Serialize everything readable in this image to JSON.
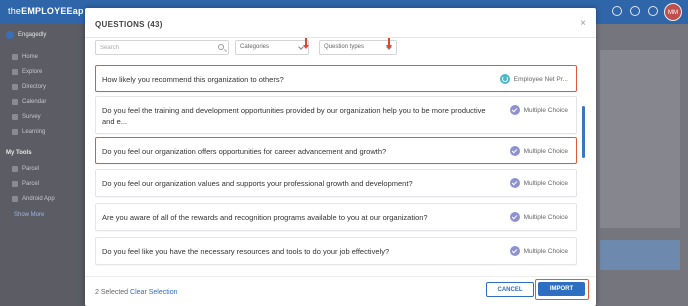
{
  "app": {
    "logo_the": "the",
    "logo_brand": "EMPLOYEEap",
    "avatar_initials": "MM",
    "header_icons": [
      "bell-icon",
      "help-icon",
      "gear-icon"
    ]
  },
  "sidebar": {
    "org": "Engagedly",
    "items": [
      {
        "label": "Home",
        "icon": "home-icon"
      },
      {
        "label": "Explore",
        "icon": "explore-icon"
      },
      {
        "label": "Directory",
        "icon": "directory-icon"
      },
      {
        "label": "Calendar",
        "icon": "calendar-icon"
      },
      {
        "label": "Survey",
        "icon": "survey-icon"
      },
      {
        "label": "Learning",
        "icon": "learning-icon"
      }
    ],
    "section_title": "My Tools",
    "tools": [
      {
        "label": "Parcel"
      },
      {
        "label": "Parcel"
      },
      {
        "label": "Android App"
      }
    ],
    "show_more": "Show More"
  },
  "modal": {
    "title": "QUESTIONS (43)",
    "close": "×",
    "search_placeholder": "Search",
    "filter_categories": "Categories",
    "filter_question_types": "Question types",
    "questions": [
      {
        "text": "How likely you recommend this organization to others?",
        "type": "Employee Net Pr...",
        "icon": "nps-icon",
        "selected": true
      },
      {
        "text": "Do you feel the training and development opportunities provided by our organization help you to be more productive and e...",
        "type": "Multiple Choice",
        "icon": "multiple-choice-icon",
        "selected": false
      },
      {
        "text": "Do you feel our organization offers opportunities for career advancement and growth?",
        "type": "Multiple Choice",
        "icon": "multiple-choice-icon",
        "selected": true
      },
      {
        "text": "Do you feel our organization values and supports your professional growth and development?",
        "type": "Multiple Choice",
        "icon": "multiple-choice-icon",
        "selected": false
      },
      {
        "text": "Are you aware of all of the rewards and recognition programs available to you at our organization?",
        "type": "Multiple Choice",
        "icon": "multiple-choice-icon",
        "selected": false
      },
      {
        "text": "Do you feel like you have the necessary resources and tools to do your job effectively?",
        "type": "Multiple Choice",
        "icon": "multiple-choice-icon",
        "selected": false
      }
    ],
    "footer": {
      "selected_count": "2 Selected",
      "clear_selection": "Clear Selection",
      "cancel_label": "CANCEL",
      "import_label": "IMPORT"
    }
  },
  "colors": {
    "accent": "#2f6fc1",
    "highlight": "#e05a3a",
    "header": "#2f66a9"
  }
}
